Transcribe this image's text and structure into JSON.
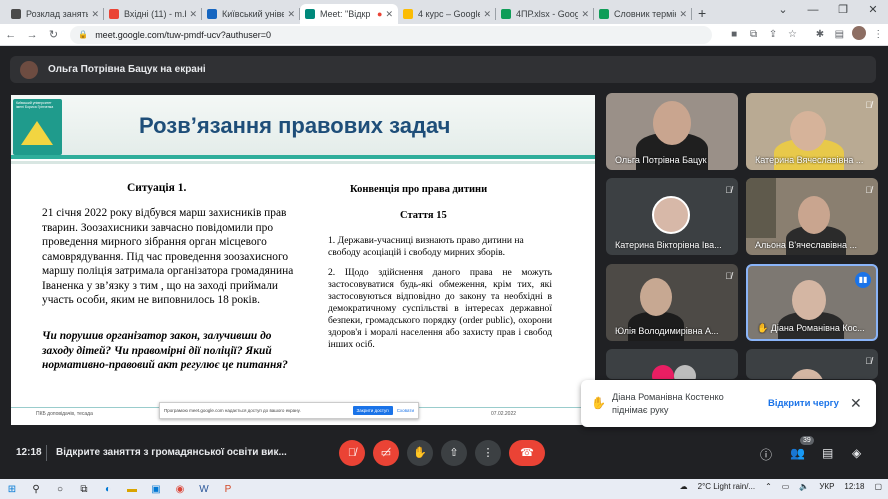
{
  "browser": {
    "tabs": [
      {
        "label": "Розклад занять",
        "color": "#4a4a4a"
      },
      {
        "label": "Вхідні (11) - m.bu",
        "color": "#ea4335"
      },
      {
        "label": "Київський універ",
        "color": "#1565c0"
      },
      {
        "label": "Meet: \"Відкр",
        "color": "#00897b"
      },
      {
        "label": "4 курс – Google",
        "color": "#fbbc04"
      },
      {
        "label": "4ПР.xlsx - Google",
        "color": "#0f9d58"
      },
      {
        "label": "Словник термін",
        "color": "#0f9d58"
      }
    ],
    "url": "meet.google.com/tuw-pmdf-ucv?authuser=0"
  },
  "presenter_bar": {
    "label": "Ольга Потрівна Бацук на екрані"
  },
  "slide": {
    "title": "Розв’язання правових задач",
    "logo_text": "Київський університет імені Бориса Грінченка",
    "left": {
      "heading": "Ситуація 1.",
      "paragraph": "21 січня 2022 року відбувся марш захисників прав тварин. Зоозахисники завчасно повідомили про проведення мирного зібрання орган місцевого самоврядування. Під час проведення зоозахисного маршу поліція затримала організатора громадянина Іваненка у зв’язку з тим , що на заході приймали участь особи, яким не виповнилось 18 років.",
      "question": "Чи порушив організатор закон, залучивши до заходу дітей? Чи правомірні дії поліції? Який нормативно-правовий акт регулює це питання?"
    },
    "right": {
      "heading": "Конвенція про права дитини",
      "article": "Стаття 15",
      "p1": "1. Держави-учасниці визнають право дитини на свободу асоціацій і свободу мирних зборів.",
      "p2": "2. Щодо здійснення даного права не можуть застосовуватися будь-які обмеження, крім тих, які застосовуються відповідно до закону та необхідні в демократичному суспільстві в інтересах державної безпеки, громадського порядку (order public), охорони здоров'я і моралі населення або захисту прав і свобод інших осіб."
    },
    "footer_left": "ПКБ доповідачів, тесада",
    "footer_date": "07.02.2022",
    "share_notice": "Програмою meet.google.com надається доступ до вашого екрану.",
    "share_stop": "Закрити доступ",
    "share_hide": "Сховати"
  },
  "participants": [
    {
      "name": "Ольга Потрівна Бацук",
      "bg": "#9a9088"
    },
    {
      "name": "Катерина Вячеславівна ...",
      "bg": "#b9aa93"
    },
    {
      "name": "Катерина Вікторівна Іва...",
      "bg": "#3c4043"
    },
    {
      "name": "Альона В'ячеславівна ...",
      "bg": "#8a7f70"
    },
    {
      "name": "Юлія Володимирівна А...",
      "bg": "#4d4a46"
    },
    {
      "name": "Діана Романівна Кос...",
      "bg": "#7d7872"
    },
    {
      "name": "",
      "bg": "#3c4043"
    },
    {
      "name": "",
      "bg": "#3c4043"
    }
  ],
  "toast": {
    "message": "Діана Романівна Костенко піднімає руку",
    "action": "Відкрити чергу"
  },
  "bottom_bar": {
    "time": "12:18",
    "meeting_title": "Відкрите заняття з громадянської освіти вик...",
    "people_count": "39"
  },
  "taskbar": {
    "weather": "2°C  Light rain/...",
    "lang": "УКР",
    "clock": "12:18"
  }
}
